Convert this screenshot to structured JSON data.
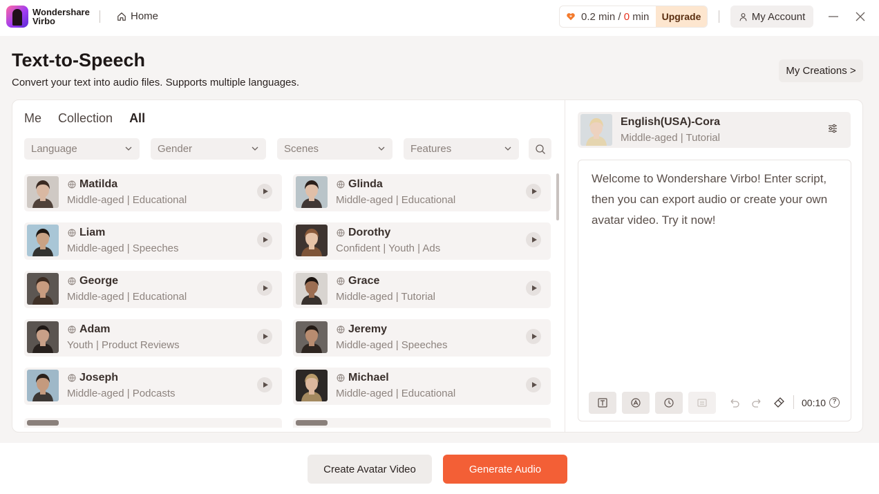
{
  "app": {
    "brand_line1": "Wondershare",
    "brand_line2": "Virbo",
    "home_label": "Home",
    "quota_used": "0.2 min",
    "quota_sep": " / ",
    "quota_total_num": "0",
    "quota_total_unit": " min",
    "upgrade_label": "Upgrade",
    "account_label": "My Account"
  },
  "header": {
    "title": "Text-to-Speech",
    "subtitle": "Convert your text into audio files. Supports multiple languages.",
    "creations_label": "My Creations >"
  },
  "tabs": [
    {
      "label": "Me",
      "active": false
    },
    {
      "label": "Collection",
      "active": false
    },
    {
      "label": "All",
      "active": true
    }
  ],
  "filters": [
    {
      "label": "Language"
    },
    {
      "label": "Gender"
    },
    {
      "label": "Scenes"
    },
    {
      "label": "Features"
    }
  ],
  "voices": [
    {
      "name": "Matilda",
      "desc": "Middle-aged | Educational",
      "skin": "#d9b8a2",
      "hair": "#3a2a22",
      "bg": "#cfc9c4"
    },
    {
      "name": "Glinda",
      "desc": "Middle-aged | Educational",
      "skin": "#e0bfa8",
      "hair": "#2a1f1a",
      "bg": "#b9c4c9"
    },
    {
      "name": "Liam",
      "desc": "Middle-aged | Speeches",
      "skin": "#c9a284",
      "hair": "#1e1712",
      "bg": "#a9c6d6"
    },
    {
      "name": "Dorothy",
      "desc": "Confident | Youth | Ads",
      "skin": "#e6c3a8",
      "hair": "#8a5a3a",
      "bg": "#3e3430"
    },
    {
      "name": "George",
      "desc": "Middle-aged | Educational",
      "skin": "#c89c80",
      "hair": "#3b2a20",
      "bg": "#5c5652"
    },
    {
      "name": "Grace",
      "desc": "Middle-aged | Tutorial",
      "skin": "#9c6e52",
      "hair": "#1c1410",
      "bg": "#d8d4d0"
    },
    {
      "name": "Adam",
      "desc": "Youth | Product Reviews",
      "skin": "#c8a088",
      "hair": "#1e1714",
      "bg": "#5a5450"
    },
    {
      "name": "Jeremy",
      "desc": "Middle-aged | Speeches",
      "skin": "#b88c70",
      "hair": "#231a15",
      "bg": "#6a6460"
    },
    {
      "name": "Joseph",
      "desc": "Middle-aged | Podcasts",
      "skin": "#c49a7e",
      "hair": "#2a201a",
      "bg": "#9fb8c8"
    },
    {
      "name": "Michael",
      "desc": "Middle-aged | Educational",
      "skin": "#dcb89e",
      "hair": "#b89a6a",
      "bg": "#2c2826"
    }
  ],
  "selected_voice": {
    "name": "English(USA)-Cora",
    "desc": "Middle-aged | Tutorial",
    "skin": "#edd2bf",
    "hair": "#e8d3a6",
    "bg": "#d8dde0"
  },
  "editor": {
    "script": "Welcome to Wondershare Virbo! Enter script, then you can export audio or create your own avatar video. Try it now!",
    "duration": "00:10",
    "help": "?"
  },
  "footer": {
    "avatar_button": "Create Avatar Video",
    "generate_button": "Generate Audio"
  },
  "colors": {
    "accent": "#f35f36",
    "quota_zero": "#e8321f",
    "upgrade_bg": "#fde6cf"
  }
}
